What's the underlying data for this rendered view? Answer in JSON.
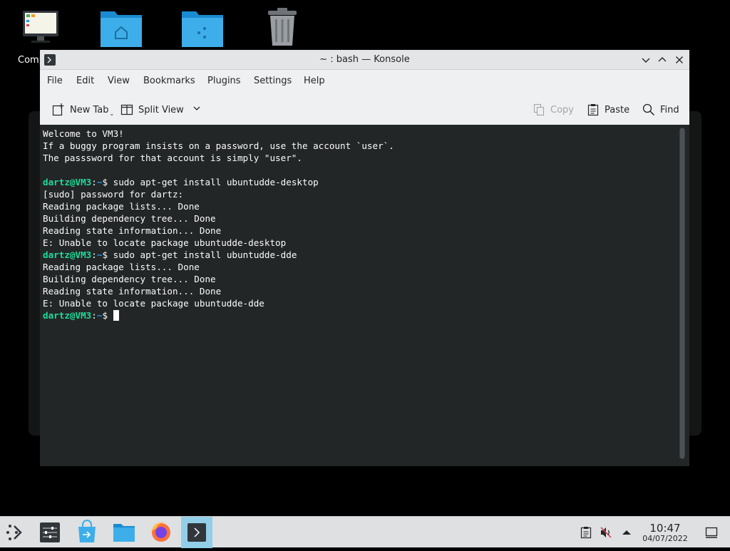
{
  "desktop": {
    "computer_label": "Comp"
  },
  "window": {
    "title": "~ : bash — Konsole",
    "controls": [
      "minimize",
      "maximize",
      "close"
    ]
  },
  "menu": [
    "File",
    "Edit",
    "View",
    "Bookmarks",
    "Plugins",
    "Settings",
    "Help"
  ],
  "toolbar": {
    "new_tab": "New Tab",
    "split_view": "Split View",
    "copy": "Copy",
    "paste": "Paste",
    "find": "Find"
  },
  "terminal": {
    "lines": [
      "Welcome to VM3!",
      "If a buggy program insists on a password, use the account `user`.",
      "The passsword for that account is simply \"user\".",
      "",
      "[sudo] password for dartz:",
      "Reading package lists... Done",
      "Building dependency tree... Done",
      "Reading state information... Done",
      "E: Unable to locate package ubuntudde-desktop",
      "Reading package lists... Done",
      "Building dependency tree... Done",
      "Reading state information... Done",
      "E: Unable to locate package ubuntudde-dde"
    ],
    "prompt_user": "dartz@VM3",
    "prompt_sep": ":",
    "prompt_path": "~",
    "prompt_symbol": "$",
    "cmd1": " sudo apt-get install ubuntudde-desktop",
    "cmd2": " sudo apt-get install ubuntudde-dde"
  },
  "taskbar": {
    "time": "10:47",
    "date": "04/07/2022"
  },
  "colors": {
    "terminal_bg": "#232627",
    "prompt_user": "#1cdc9a",
    "prompt_path": "#1d99f3",
    "folder_blue": "#3daee9",
    "taskbar_bg": "#dee0e2",
    "active_task": "#93cee9"
  }
}
